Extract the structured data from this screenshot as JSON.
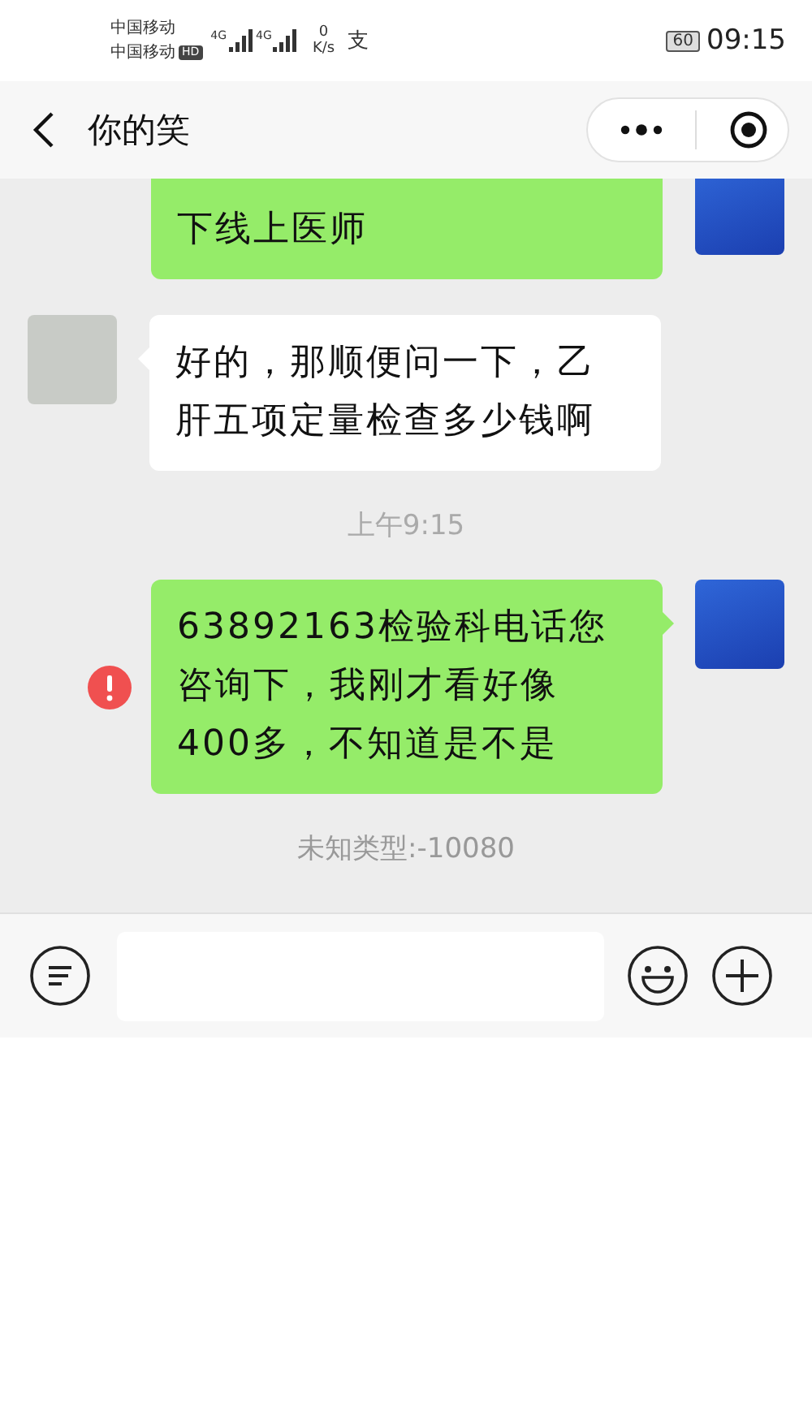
{
  "status_bar": {
    "carriers": [
      "中国移动",
      "中国移动"
    ],
    "hd_badge": "HD",
    "networks": [
      "4G",
      "4G"
    ],
    "speed_value": "0",
    "speed_unit": "K/s",
    "notification_glyph": "支",
    "battery": "60",
    "time": "09:15"
  },
  "header": {
    "title": "你的笑"
  },
  "messages": [
    {
      "kind": "sent",
      "text": "下线上医师",
      "failed": false,
      "clipped_top": true
    },
    {
      "kind": "received",
      "text": "好的，那顺便问一下，乙肝五项定量检查多少钱啊"
    },
    {
      "kind": "time",
      "text": "上午9:15"
    },
    {
      "kind": "sent",
      "text": "63892163检验科电话您咨询下，我刚才看好像400多，不知道是不是",
      "failed": true,
      "clipped_top": false
    },
    {
      "kind": "system",
      "text": "未知类型:-10080"
    }
  ]
}
